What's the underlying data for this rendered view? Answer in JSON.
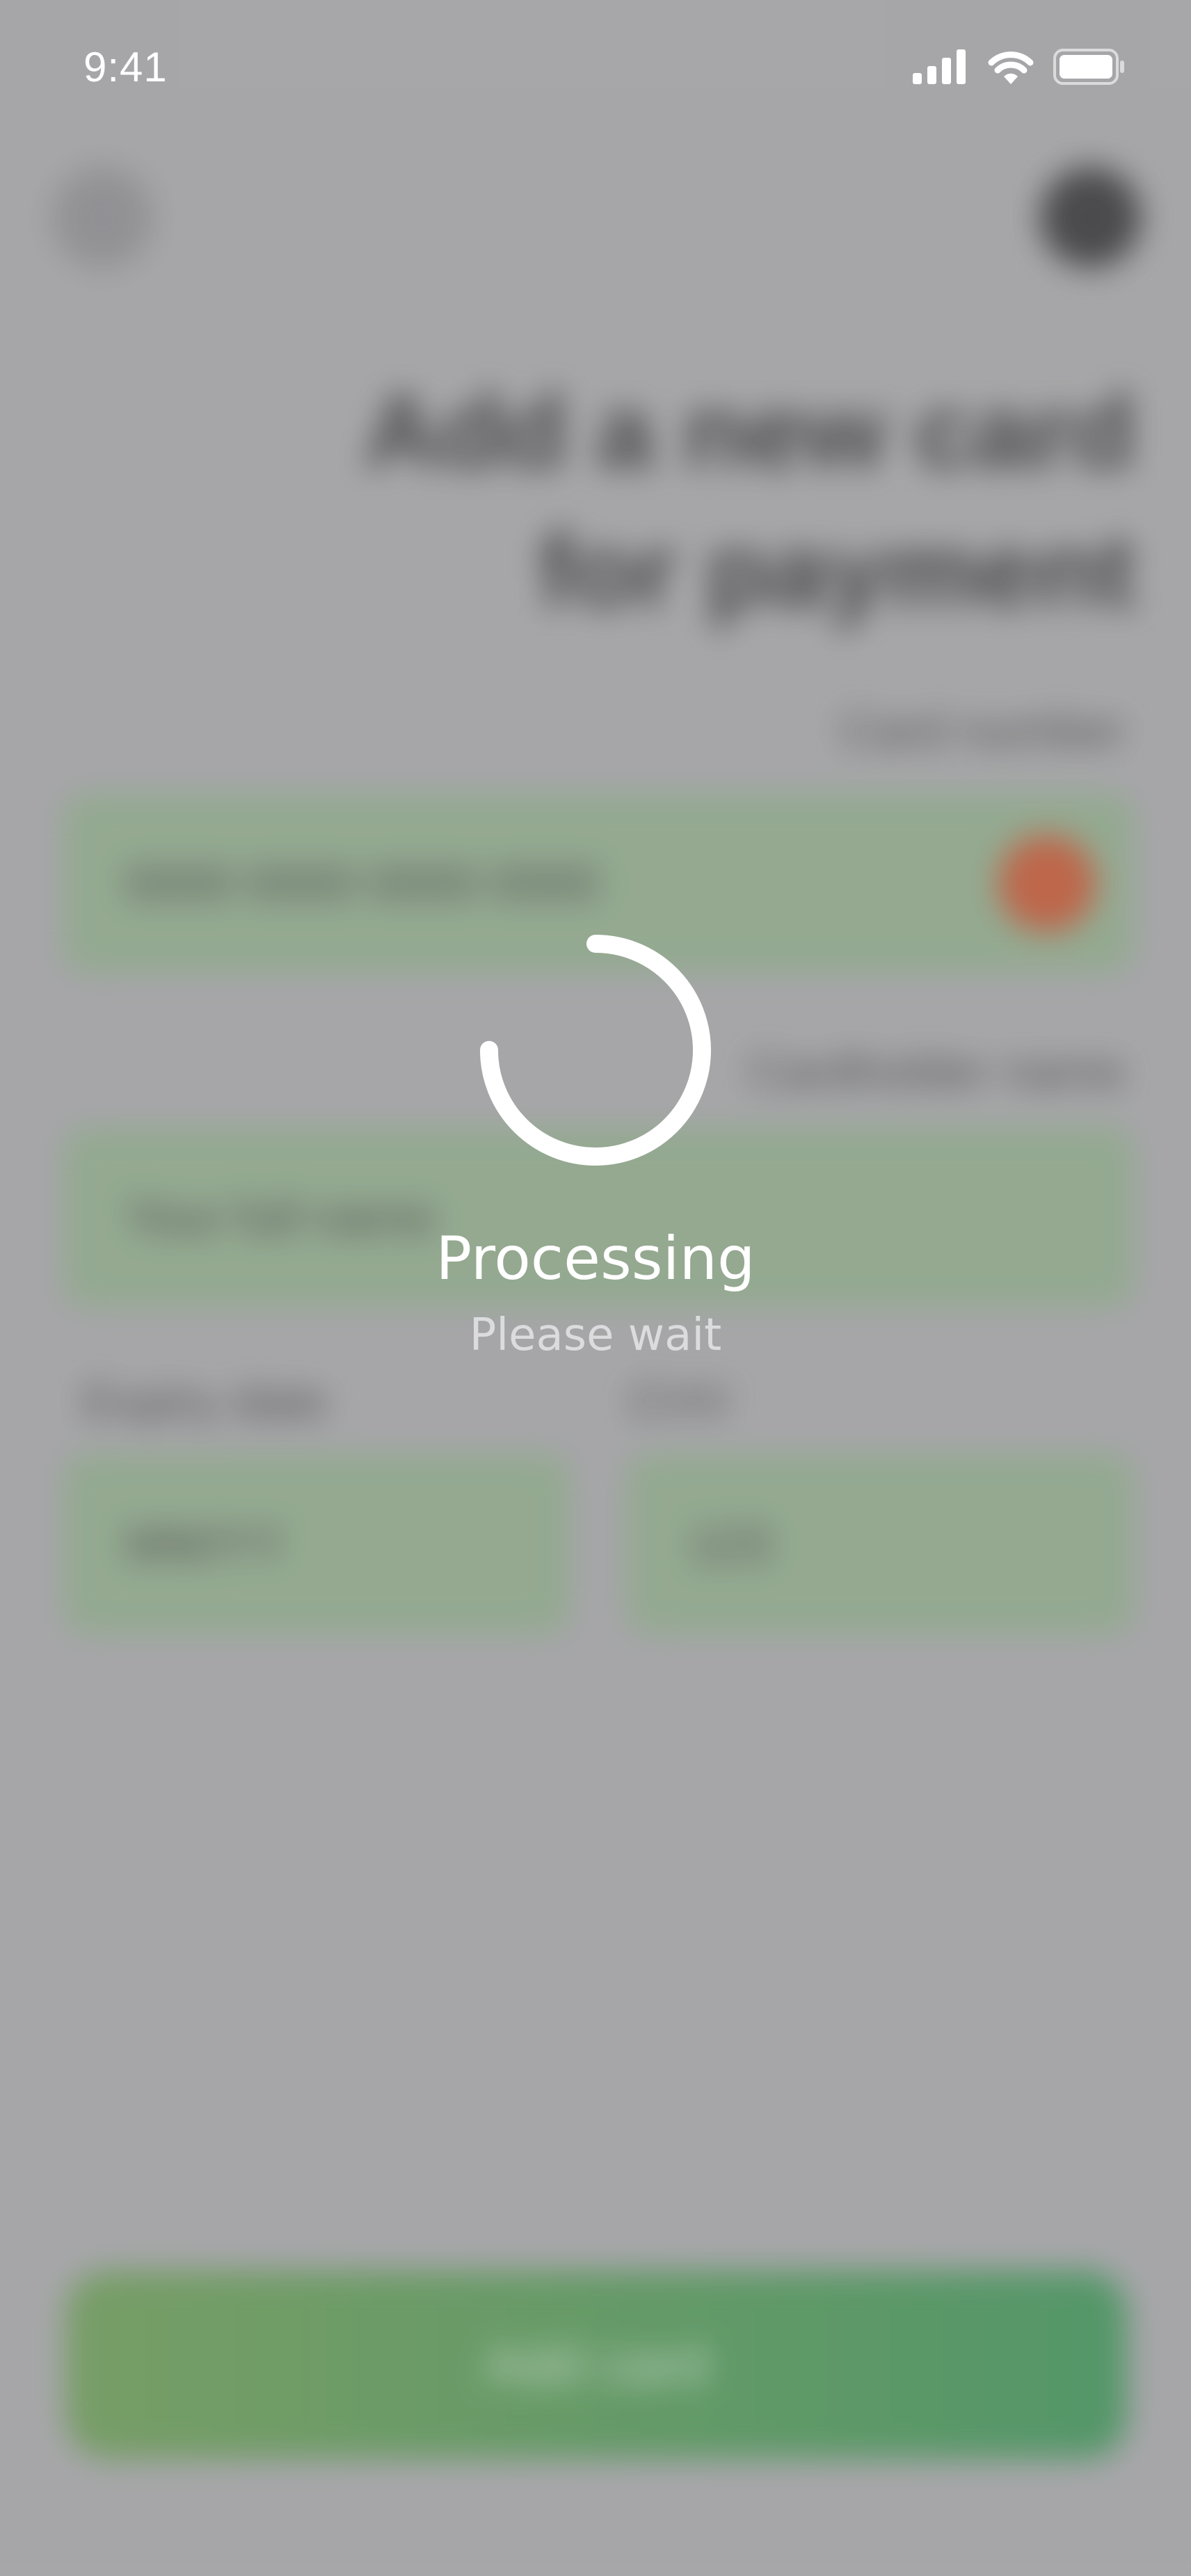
{
  "status_bar": {
    "time": "9:41",
    "icons": [
      "cellular-signal-icon",
      "wifi-icon",
      "battery-icon"
    ]
  },
  "background": {
    "title": "Add a new card for payment",
    "card_number_label": "Card number",
    "card_number_value": "0000 0000 0000 0000",
    "cardholder_label": "Cardholder name",
    "cardholder_value": "Your full name",
    "expiry_label": "Expiry date",
    "expiry_value": "MM/YY",
    "cvv_label": "CVV",
    "cvv_value": "123",
    "button_label": "Add card",
    "field_color": "#90ad8a",
    "button_gradient": [
      "#6a9d52",
      "#3b9455"
    ]
  },
  "loader": {
    "title": "Processing",
    "subtitle": "Please wait"
  }
}
